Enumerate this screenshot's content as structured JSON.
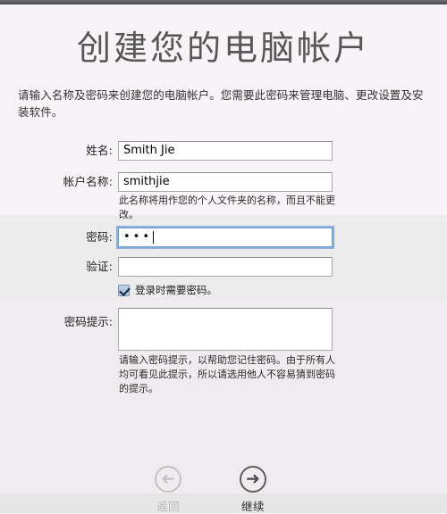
{
  "window": {
    "titlebar_color": "#5d5f66"
  },
  "page": {
    "title": "创建您的电脑帐户",
    "intro": "请输入名称及密码来创建您的电脑帐户。您需要此密码来管理电脑、更改设置及安装软件。"
  },
  "form": {
    "fields": [
      {
        "label": "姓名:",
        "value": "Smith Jie",
        "placeholder": "",
        "helper": "",
        "focused": false
      },
      {
        "label": "帐户名称:",
        "value": "smithjie",
        "placeholder": "",
        "helper": "此名称将用作您的个人文件夹的名称，而且不能更改。",
        "focused": false
      },
      {
        "label": "密码:",
        "value": "•••",
        "placeholder": "",
        "helper": "",
        "focused": true
      },
      {
        "label": "验证:",
        "value": "",
        "placeholder": "",
        "helper": "",
        "focused": false
      }
    ],
    "checkbox": {
      "label": "登录时需要密码。",
      "checked": true
    },
    "hint": {
      "label": "密码提示:",
      "value": "",
      "placeholder": "",
      "helper": "请输入密码提示，以帮助您记住密码。由于所有人均可看见此提示，所以请选用他人不容易猜到密码的提示。"
    }
  },
  "navigation": {
    "back": {
      "label": "返回",
      "icon": "arrow-left-circle-icon",
      "glyph": "➜",
      "enabled": false
    },
    "continue": {
      "label": "继续",
      "icon": "arrow-right-circle-icon",
      "glyph": "➜",
      "enabled": true
    }
  },
  "colors": {
    "background_top": "#f7f3f6",
    "background_mid": "#ececec",
    "background_lower": "#efebee",
    "background_footer": "#e5e6e6",
    "title_text": "#575757",
    "focus_ring": "#6ea0d8",
    "checkbox_fill": "#a9c3e2"
  }
}
